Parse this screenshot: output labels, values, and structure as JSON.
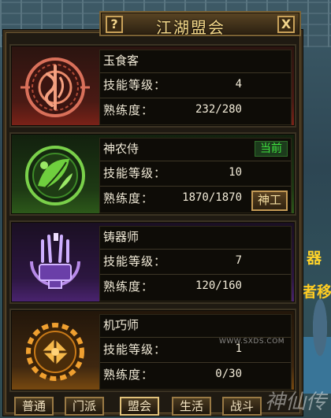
{
  "window": {
    "title": "江湖盟会",
    "help_label": "?",
    "close_label": "X"
  },
  "skills": [
    {
      "name": "玉食客",
      "level_label": "技能等级：",
      "level": "4",
      "proficiency_label": "熟练度：",
      "proficiency": "232/280",
      "theme": "red",
      "icon": "fish-emblem-icon"
    },
    {
      "name": "神农侍",
      "badge": "当前",
      "level_label": "技能等级：",
      "level": "10",
      "proficiency_label": "熟练度：",
      "proficiency": "1870/1870",
      "action_label": "神工",
      "theme": "green",
      "icon": "leaf-emblem-icon"
    },
    {
      "name": "铸器师",
      "level_label": "技能等级：",
      "level": "7",
      "proficiency_label": "熟练度：",
      "proficiency": "120/160",
      "theme": "purple",
      "icon": "anvil-emblem-icon"
    },
    {
      "name": "机巧师",
      "level_label": "技能等级：",
      "level": "1",
      "proficiency_label": "熟练度：",
      "proficiency": "0/30",
      "theme": "orange",
      "icon": "gear-emblem-icon"
    }
  ],
  "tabs": [
    "普通",
    "门派",
    "盟会",
    "生活",
    "战斗"
  ],
  "background": {
    "text_1": "器",
    "text_2": "者移"
  },
  "watermark": {
    "text": "神仙传",
    "url": "WWW.SXDS.COM"
  },
  "colors": {
    "gold": "#c9a25a",
    "current_badge": "#3fe43f"
  }
}
